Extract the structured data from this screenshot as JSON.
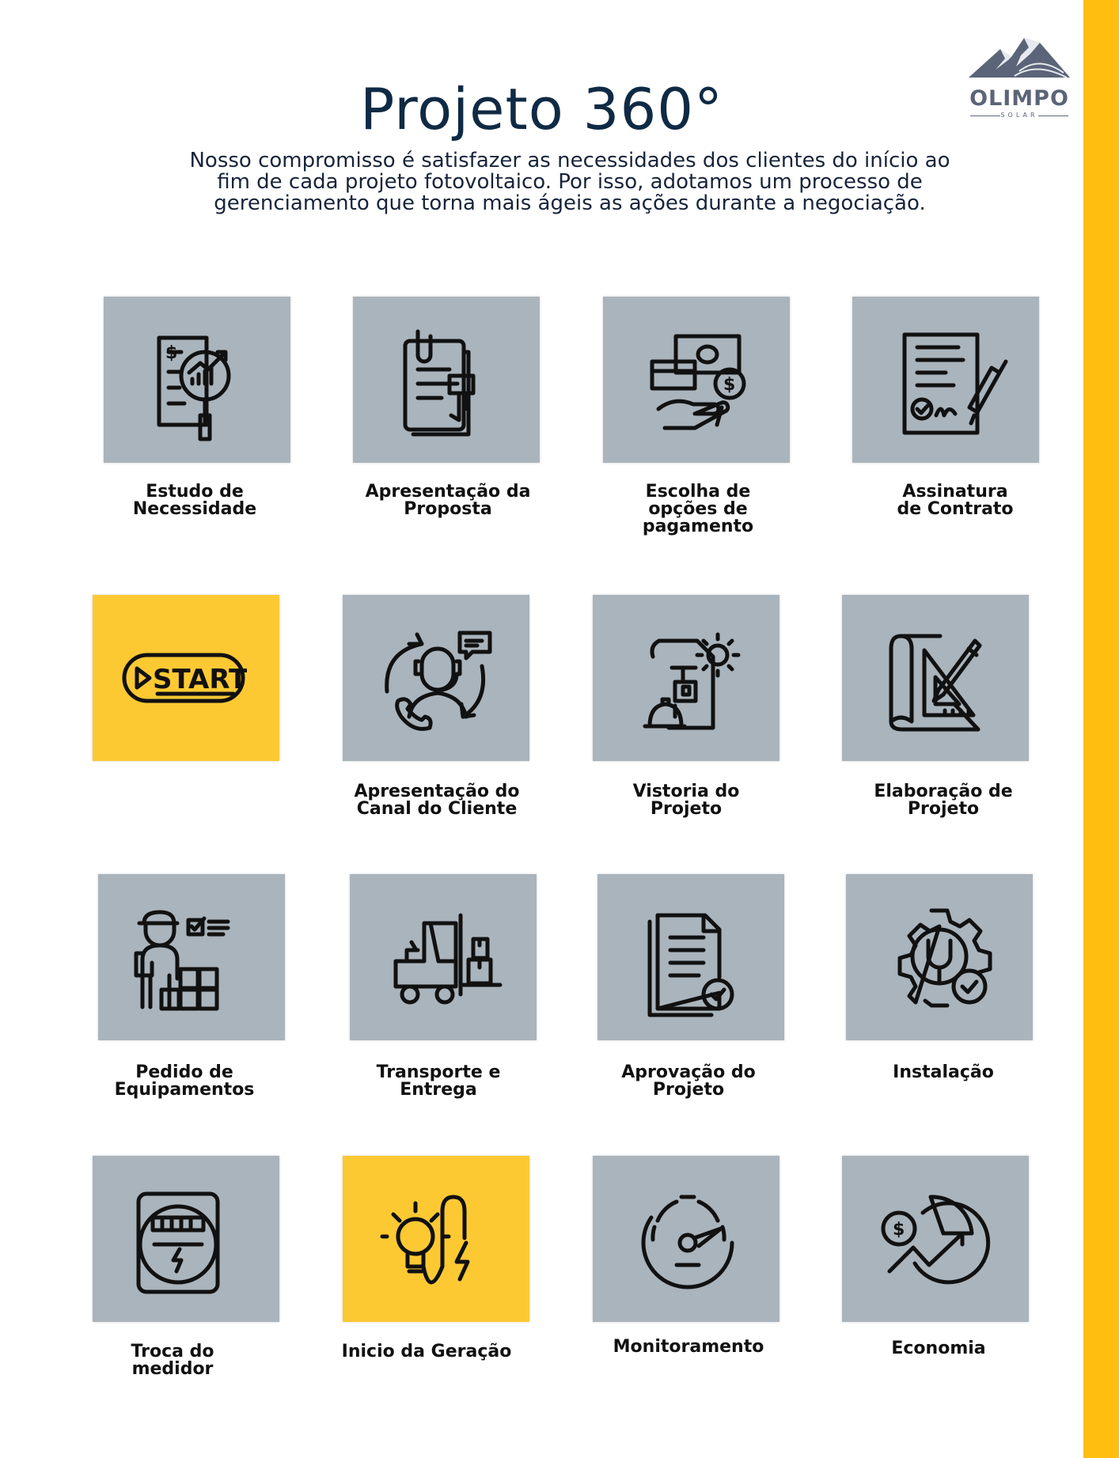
{
  "header": {
    "title": "Projeto 360°",
    "subtitle_lines": [
      "Nosso compromisso é satisfazer as necessidades dos clientes do início ao",
      "fim de cada projeto fotovoltaico. Por isso, adotamos um processo de",
      "gerenciamento que torna mais ágeis as ações durante a negociação."
    ]
  },
  "logo": {
    "name": "OLIMPO",
    "tagline": "SOLAR"
  },
  "colors": {
    "accent_yellow": "#ffbe10",
    "card_gray": "#aab4bc",
    "card_yellow": "#fdc933",
    "title_navy": "#0f2a44"
  },
  "steps": [
    {
      "icon": "financial-analysis-icon",
      "label_lines": [
        "Estudo de",
        "Necessidade"
      ],
      "highlight": false
    },
    {
      "icon": "document-proposal-icon",
      "label_lines": [
        "Apresentação da",
        "Proposta"
      ],
      "highlight": false
    },
    {
      "icon": "payment-options-icon",
      "label_lines": [
        "Escolha de",
        "opções de",
        "pagamento"
      ],
      "highlight": false
    },
    {
      "icon": "contract-signature-icon",
      "label_lines": [
        "Assinatura",
        "de Contrato"
      ],
      "highlight": false
    },
    {
      "icon": "start-icon",
      "icon_text": "START",
      "label_lines": [],
      "highlight": true
    },
    {
      "icon": "customer-support-icon",
      "label_lines": [
        "Apresentação do",
        "Canal do Cliente"
      ],
      "highlight": false
    },
    {
      "icon": "engineering-blueprint-icon",
      "label_lines": [
        "Vistoria do",
        "Projeto"
      ],
      "highlight": false
    },
    {
      "icon": "blueprint-design-icon",
      "label_lines": [
        "Elaboração de",
        "Projeto"
      ],
      "highlight": false
    },
    {
      "icon": "worker-order-icon",
      "label_lines": [
        "Pedido de",
        "Equipamentos"
      ],
      "highlight": false
    },
    {
      "icon": "forklift-icon",
      "label_lines": [
        "Transporte e",
        "Entrega"
      ],
      "highlight": false
    },
    {
      "icon": "document-approved-icon",
      "label_lines": [
        "Aprovação do",
        "Projeto"
      ],
      "highlight": false
    },
    {
      "icon": "gear-wrench-icon",
      "label_lines": [
        "Instalação"
      ],
      "highlight": false
    },
    {
      "icon": "electric-meter-icon",
      "label_lines": [
        "Troca do",
        "medidor"
      ],
      "highlight": false
    },
    {
      "icon": "lightbulb-energy-icon",
      "label_lines": [
        "Inicio da Geração"
      ],
      "highlight": true
    },
    {
      "icon": "speedometer-icon",
      "label_lines": [
        "Monitoramento"
      ],
      "highlight": false
    },
    {
      "icon": "savings-chart-icon",
      "label_lines": [
        "Economia"
      ],
      "highlight": false
    }
  ]
}
